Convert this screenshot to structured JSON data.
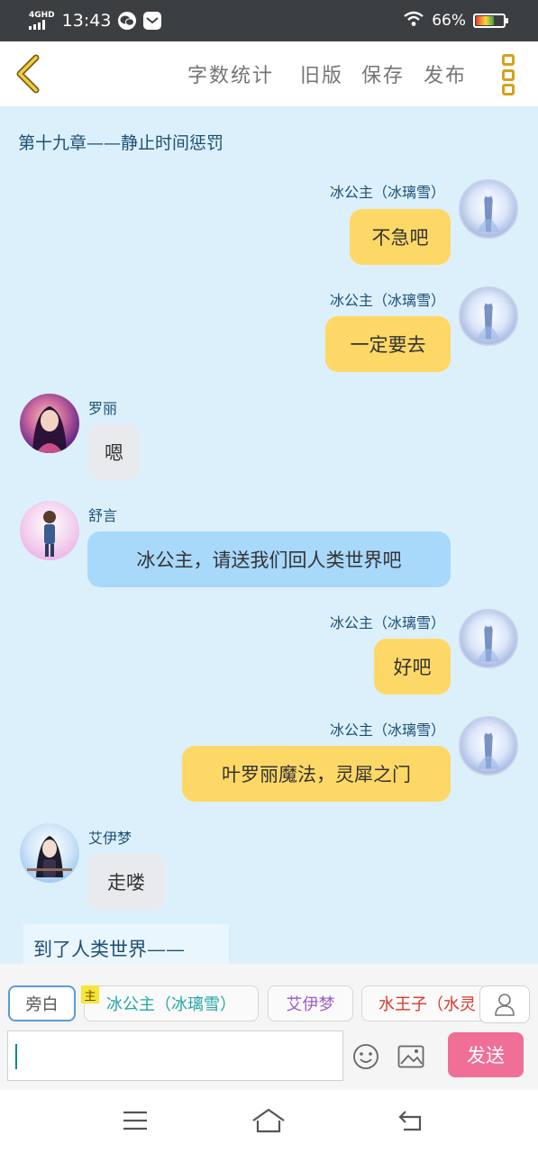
{
  "status_bar": {
    "network": "4GHD",
    "time": "13:43",
    "battery_percent": "66%",
    "battery_level": 0.66,
    "notification_icons": [
      "wechat-icon",
      "mail-app-icon"
    ]
  },
  "toolbar": {
    "items": [
      "字数统计",
      "旧版",
      "保存",
      "发布"
    ],
    "icons": [
      "chevron-left-icon",
      "more-vertical-icon"
    ],
    "accent_color": "#d4a21a"
  },
  "chat": {
    "chapter_title": "第十九章——静止时间惩罚",
    "messages": [
      {
        "sender": "冰公主（冰璃雪）",
        "text": "不急吧",
        "side": "right",
        "bubble": "yellow",
        "avatar": "ice"
      },
      {
        "sender": "冰公主（冰璃雪）",
        "text": "一定要去",
        "side": "right",
        "bubble": "yellow",
        "avatar": "ice"
      },
      {
        "sender": "罗丽",
        "text": "嗯",
        "side": "left",
        "bubble": "gray",
        "avatar": "rose"
      },
      {
        "sender": "舒言",
        "text": "冰公主，请送我们回人类世界吧",
        "side": "left",
        "bubble": "blue",
        "avatar": "pink"
      },
      {
        "sender": "冰公主（冰璃雪）",
        "text": "好吧",
        "side": "right",
        "bubble": "yellow",
        "avatar": "ice"
      },
      {
        "sender": "冰公主（冰璃雪）",
        "text": "叶罗丽魔法，灵犀之门",
        "side": "right",
        "bubble": "yellow",
        "avatar": "ice"
      },
      {
        "sender": "艾伊梦",
        "text": "走喽",
        "side": "left",
        "bubble": "gray",
        "avatar": "sky"
      }
    ],
    "narration": "到了人类世界——",
    "colors": {
      "background": "#dcf0fc",
      "yellow_bubble": "#fed866",
      "gray_bubble": "#e8eaee",
      "blue_bubble": "#a8d8fa",
      "name": "#1d4f73"
    }
  },
  "role_bar": {
    "roles": [
      {
        "label": "旁白",
        "color": "#555555",
        "active": true
      },
      {
        "label": "冰公主（冰璃雪）",
        "color": "#26a6a6",
        "badge": "主"
      },
      {
        "label": "艾伊梦",
        "color": "#a05cc8"
      },
      {
        "label": "水王子（水灵",
        "color": "#d93a2b"
      }
    ],
    "person_icon": "person-icon"
  },
  "composer": {
    "input_value": "",
    "emoji_icon": "emoji-icon",
    "image_icon": "image-icon",
    "send_label": "发送",
    "send_color": "#ef6f97"
  },
  "nav_bar": {
    "icons": [
      "menu-icon",
      "home-icon",
      "back-icon"
    ]
  }
}
